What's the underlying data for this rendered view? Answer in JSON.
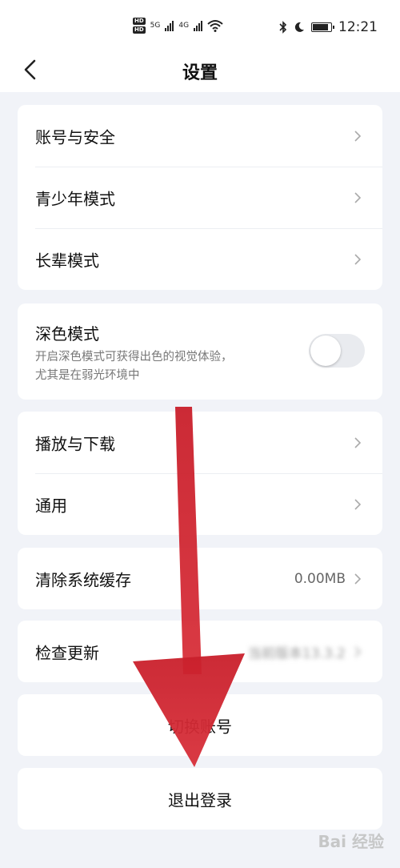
{
  "status_bar": {
    "time": "12:21",
    "network_1": "5G",
    "network_2": "4G",
    "hd_1": "HD",
    "hd_2": "HD",
    "icons": [
      "bluetooth-icon",
      "moon-icon",
      "battery-icon"
    ]
  },
  "header": {
    "title": "设置",
    "back_icon": "back-arrow-icon"
  },
  "groups": {
    "account": [
      {
        "label": "账号与安全"
      },
      {
        "label": "青少年模式"
      },
      {
        "label": "长辈模式"
      }
    ],
    "dark_mode": {
      "title": "深色模式",
      "desc_line1": "开启深色模式可获得出色的视觉体验，",
      "desc_line2": "尤其是在弱光环境中",
      "enabled": false
    },
    "media": [
      {
        "label": "播放与下载"
      },
      {
        "label": "通用"
      }
    ],
    "cache": {
      "label": "清除系统缓存",
      "value": "0.00MB"
    },
    "update": {
      "label": "检查更新",
      "value": "当前版本13.3.2"
    },
    "switch_account": {
      "label": "切换账号"
    },
    "logout": {
      "label": "退出登录"
    }
  },
  "overlay": {
    "arrow_color": "#d22630",
    "watermark": "Bai 经验"
  }
}
